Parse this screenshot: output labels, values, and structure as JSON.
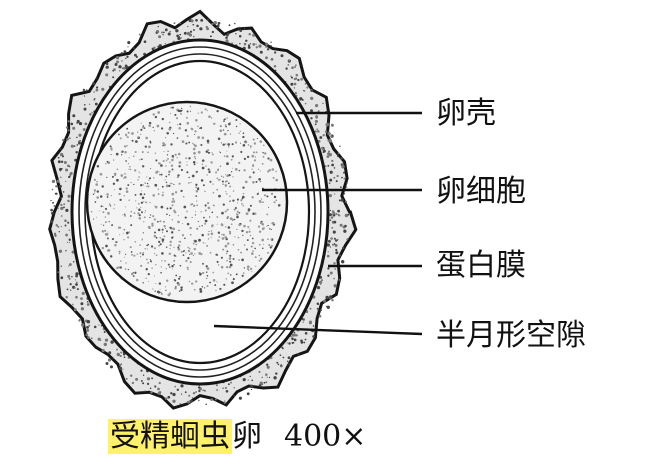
{
  "labels": {
    "eggshell": "卵壳",
    "egg_cell": "卵细胞",
    "albumin_layer": "蛋白膜",
    "crescent_space": "半月形空隙"
  },
  "caption": {
    "highlighted": "受精蛔虫",
    "rest": "卵",
    "magnification": "400×"
  },
  "colors": {
    "ink": "#111111",
    "highlight": "#fff26a",
    "background": "#ffffff"
  }
}
